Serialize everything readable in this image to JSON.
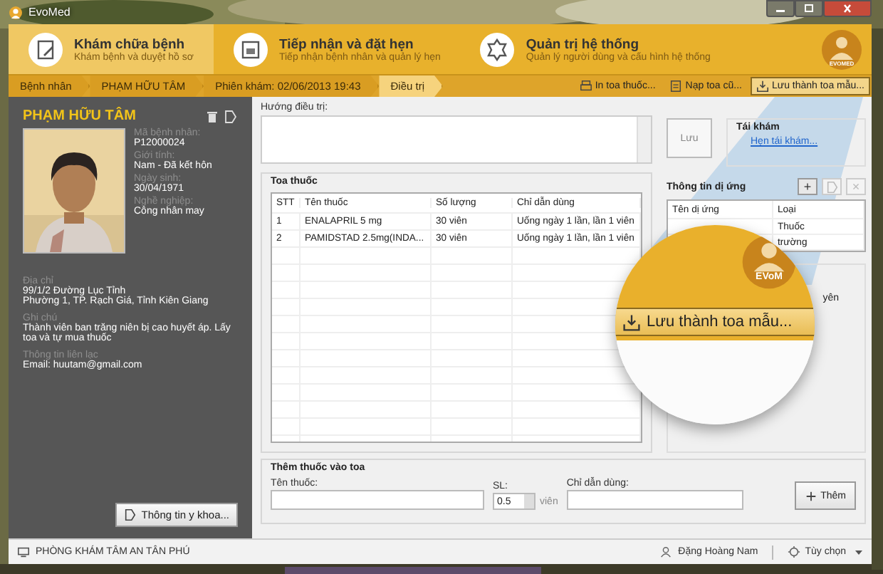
{
  "window": {
    "title": "EvoMed"
  },
  "nav_tabs": [
    {
      "title": "Khám chữa bệnh",
      "subtitle": "Khám bệnh và duyệt hồ sơ",
      "selected": true
    },
    {
      "title": "Tiếp nhận và đặt hẹn",
      "subtitle": "Tiếp nhận bệnh nhân và quản lý hẹn",
      "selected": false
    },
    {
      "title": "Quản trị hệ thống",
      "subtitle": "Quản lý người dùng và cấu hình hệ thống",
      "selected": false
    }
  ],
  "logo": {
    "text": "EVOMED"
  },
  "breadcrumb": [
    {
      "label": "Bệnh nhân",
      "selected": false
    },
    {
      "label": "PHẠM HỮU TÂM",
      "selected": false
    },
    {
      "label": "Phiên khám: 02/06/2013 19:43",
      "selected": false
    },
    {
      "label": "Điều trị",
      "selected": true
    }
  ],
  "toolbar": [
    {
      "label": "In toa thuốc...",
      "highlighted": false
    },
    {
      "label": "Nạp toa cũ...",
      "highlighted": false
    },
    {
      "label": "Lưu thành toa mẫu...",
      "highlighted": true
    }
  ],
  "patient": {
    "name": "PHẠM HỮU TÂM",
    "fields": [
      {
        "label": "Mã bệnh nhân:",
        "value": "P12000024"
      },
      {
        "label": "Giới tính:",
        "value": "Nam - Đã kết hôn"
      },
      {
        "label": "Ngày sinh:",
        "value": "30/04/1971"
      },
      {
        "label": "Nghề nghiệp:",
        "value": "Công nhân may"
      }
    ],
    "details": [
      {
        "label": "Địa chỉ",
        "lines": [
          "99/1/2 Đường Lục Tỉnh",
          "Phường 1, TP. Rạch Giá, Tỉnh Kiên Giang"
        ]
      },
      {
        "label": "Ghi chú",
        "lines": [
          "Thành viên ban trăng niên bị cao huyết áp. Lấy toa và tự mua thuốc"
        ]
      },
      {
        "label": "Thông tin liên lạc",
        "lines": [
          "Email: huutam@gmail.com"
        ]
      }
    ],
    "medical_button": "Thông tin y khoa..."
  },
  "treatment": {
    "label": "Hướng điều trị:"
  },
  "save_button": "Lưu",
  "follow_up": {
    "title": "Tái khám",
    "link": "Hẹn tái khám..."
  },
  "prescription": {
    "title": "Toa thuốc",
    "columns": [
      "STT",
      "Tên thuốc",
      "Số lượng",
      "Chỉ dẫn dùng"
    ],
    "rows": [
      [
        "1",
        "ENALAPRIL 5 mg",
        "30 viên",
        "Uống ngày 1 lần, lần 1 viên"
      ],
      [
        "2",
        "PAMIDSTAD 2.5mg(INDA...",
        "30 viên",
        "Uống ngày 1 lần, lần 1 viên"
      ]
    ]
  },
  "allergy": {
    "title": "Thông tin dị ứng",
    "actions": [
      {
        "kind": "add",
        "label": "+",
        "disabled": false
      },
      {
        "kind": "edit",
        "disabled": true
      },
      {
        "kind": "delete",
        "label": "×",
        "disabled": true
      }
    ],
    "columns": [
      "Tên dị ứng",
      "Loại"
    ],
    "rows": [
      {
        "type": "Thuốc"
      },
      {
        "type": "trường"
      }
    ]
  },
  "other_panel": {
    "fragment": "yên"
  },
  "add_drug": {
    "title": "Thêm thuốc vào toa",
    "name_label": "Tên thuốc:",
    "qty_label": "SL:",
    "qty": "0.5",
    "unit": "viên",
    "usage_label": "Chỉ dẫn dùng:",
    "add_button": "Thêm"
  },
  "status_bar": {
    "clinic": "PHÒNG KHÁM TÂM AN TÂN PHÚ",
    "user": "Đặng Hoàng Nam",
    "options": "Tùy chọn"
  },
  "magnifier": {
    "button_label": "Lưu thành toa mẫu...",
    "logo_text": "EVoM"
  }
}
